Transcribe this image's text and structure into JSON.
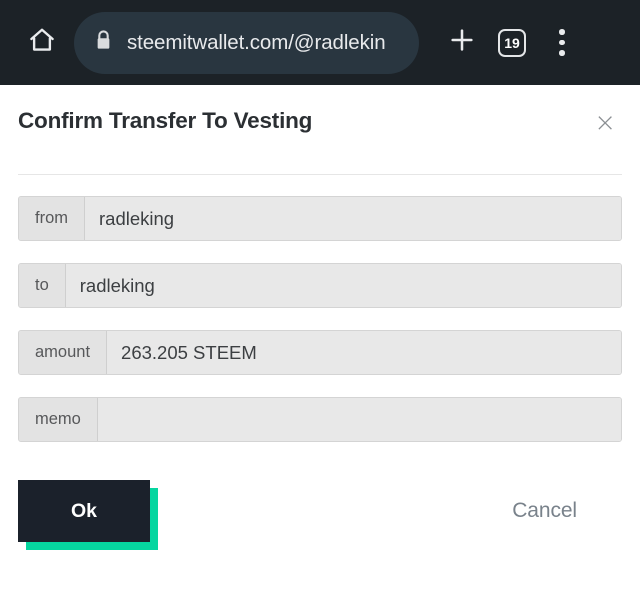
{
  "browser": {
    "home_icon": "home-icon",
    "lock_icon": "lock-icon",
    "url": "steemitwallet.com/@radlekin",
    "new_tab_icon": "plus-icon",
    "tab_count": "19",
    "menu_icon": "more-vertical-icon"
  },
  "dialog": {
    "title": "Confirm Transfer To Vesting",
    "close_label": "×",
    "fields": [
      {
        "label": "from",
        "value": "radleking"
      },
      {
        "label": "to",
        "value": "radleking"
      },
      {
        "label": "amount",
        "value": "263.205 STEEM"
      },
      {
        "label": "memo",
        "value": ""
      }
    ],
    "ok_label": "Ok",
    "cancel_label": "Cancel"
  },
  "colors": {
    "toolbar_bg": "#1c2227",
    "address_pill_bg": "#293640",
    "accent_teal": "#06d6a0",
    "ok_button_bg": "#1b212b",
    "field_bg": "#e8e8e8",
    "field_label_bg": "#e3e3e3"
  }
}
